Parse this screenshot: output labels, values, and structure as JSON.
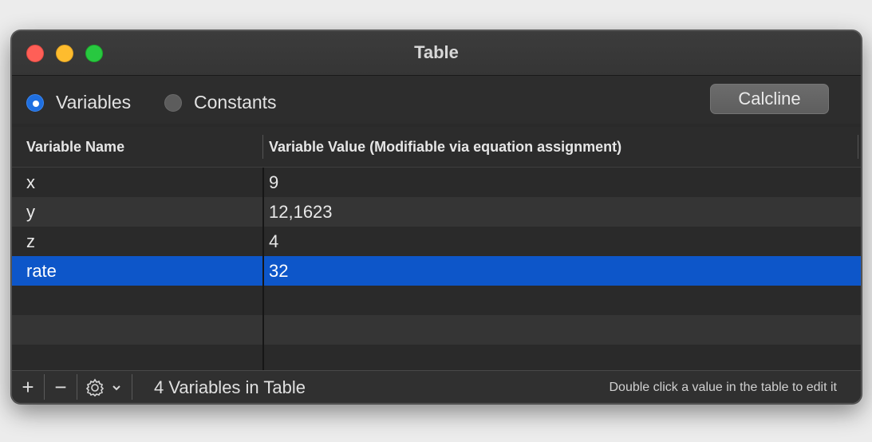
{
  "window": {
    "title": "Table"
  },
  "mode": {
    "options": [
      {
        "label": "Variables",
        "selected": true
      },
      {
        "label": "Constants",
        "selected": false
      }
    ]
  },
  "toolbar": {
    "calcline_label": "Calcline"
  },
  "table": {
    "columns": [
      "Variable Name",
      "Variable Value (Modifiable via equation assignment)"
    ],
    "rows": [
      {
        "name": "x",
        "value": "9",
        "selected": false
      },
      {
        "name": "y",
        "value": "12,1623",
        "selected": false
      },
      {
        "name": "z",
        "value": "4",
        "selected": false
      },
      {
        "name": "rate",
        "value": "32",
        "selected": true
      }
    ]
  },
  "footer": {
    "add_label": "+",
    "remove_label": "−",
    "action_icon": "gear-icon",
    "count_text": "4 Variables in Table",
    "hint_text": "Double click a value in the table to edit it"
  },
  "colors": {
    "selection": "#0d56c9",
    "radio_on": "#1f6fe0",
    "close": "#ff5f57",
    "minimize": "#febc2e",
    "zoom": "#28c840"
  }
}
